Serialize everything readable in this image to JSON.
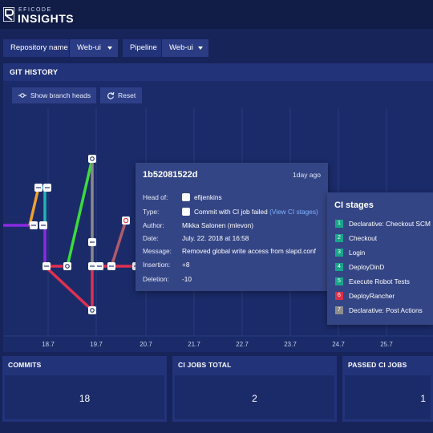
{
  "app": {
    "logo_top": "EFICODE",
    "logo_main": "INSIGHTS",
    "logo_mark_color": "#ffffff"
  },
  "filters": {
    "repository_label": "Repository name",
    "repository_value": "Web-ui",
    "pipeline_label": "Pipeline",
    "pipeline_value": "Web-ui"
  },
  "git_history": {
    "title": "GIT HISTORY",
    "show_branch_heads_label": "Show branch heads",
    "reset_label": "Reset",
    "x_ticks": [
      "18.7",
      "19.7",
      "20.7",
      "21.7",
      "22.7",
      "23.7",
      "24.7",
      "25.7"
    ],
    "branch_colors": {
      "purple": "#8a2be2",
      "orange": "#f0a030",
      "teal": "#1fb5b5",
      "green": "#3bdc3b",
      "gray": "#8a8a8a",
      "red": "#e03050",
      "mauve": "#b05a6a"
    }
  },
  "tooltip": {
    "hash": "1b52081522d",
    "age": "1day ago",
    "head_of_label": "Head of:",
    "head_of_value": "efijenkins",
    "type_label": "Type:",
    "type_value": "Commit with CI job failed",
    "type_link": "(View CI stages)",
    "author_label": "Author:",
    "author_value": "Mikka Salonen (mlevon)",
    "date_label": "Date:",
    "date_value": "July. 22. 2018 at 16:58",
    "message_label": "Message:",
    "message_value": "Removed global write access from slapd.conf",
    "insertion_label": "Insertion:",
    "insertion_value": "+8",
    "deletion_label": "Deletion:",
    "deletion_value": "-10"
  },
  "ci_stages": {
    "title": "CI stages",
    "stages": [
      {
        "num": "1",
        "name": "Declarative: Checkout SCM",
        "color": "#1aa58a"
      },
      {
        "num": "2",
        "name": "Checkout",
        "color": "#1aa58a"
      },
      {
        "num": "3",
        "name": "Login",
        "color": "#1aa58a"
      },
      {
        "num": "4",
        "name": "DeployDinD",
        "color": "#1aa58a"
      },
      {
        "num": "5",
        "name": "Execute Robot Tests",
        "color": "#1aa58a"
      },
      {
        "num": "6",
        "name": "DeployRancher",
        "color": "#d9304a"
      },
      {
        "num": "7",
        "name": "Declarative: Post Actions",
        "color": "#8d8d8d"
      }
    ]
  },
  "stats": {
    "commits_label": "COMMITS",
    "commits_value": "18",
    "ci_jobs_total_label": "CI JOBS TOTAL",
    "ci_jobs_total_value": "2",
    "passed_ci_jobs_label": "PASSED CI JOBS",
    "passed_ci_jobs_value": "1"
  }
}
